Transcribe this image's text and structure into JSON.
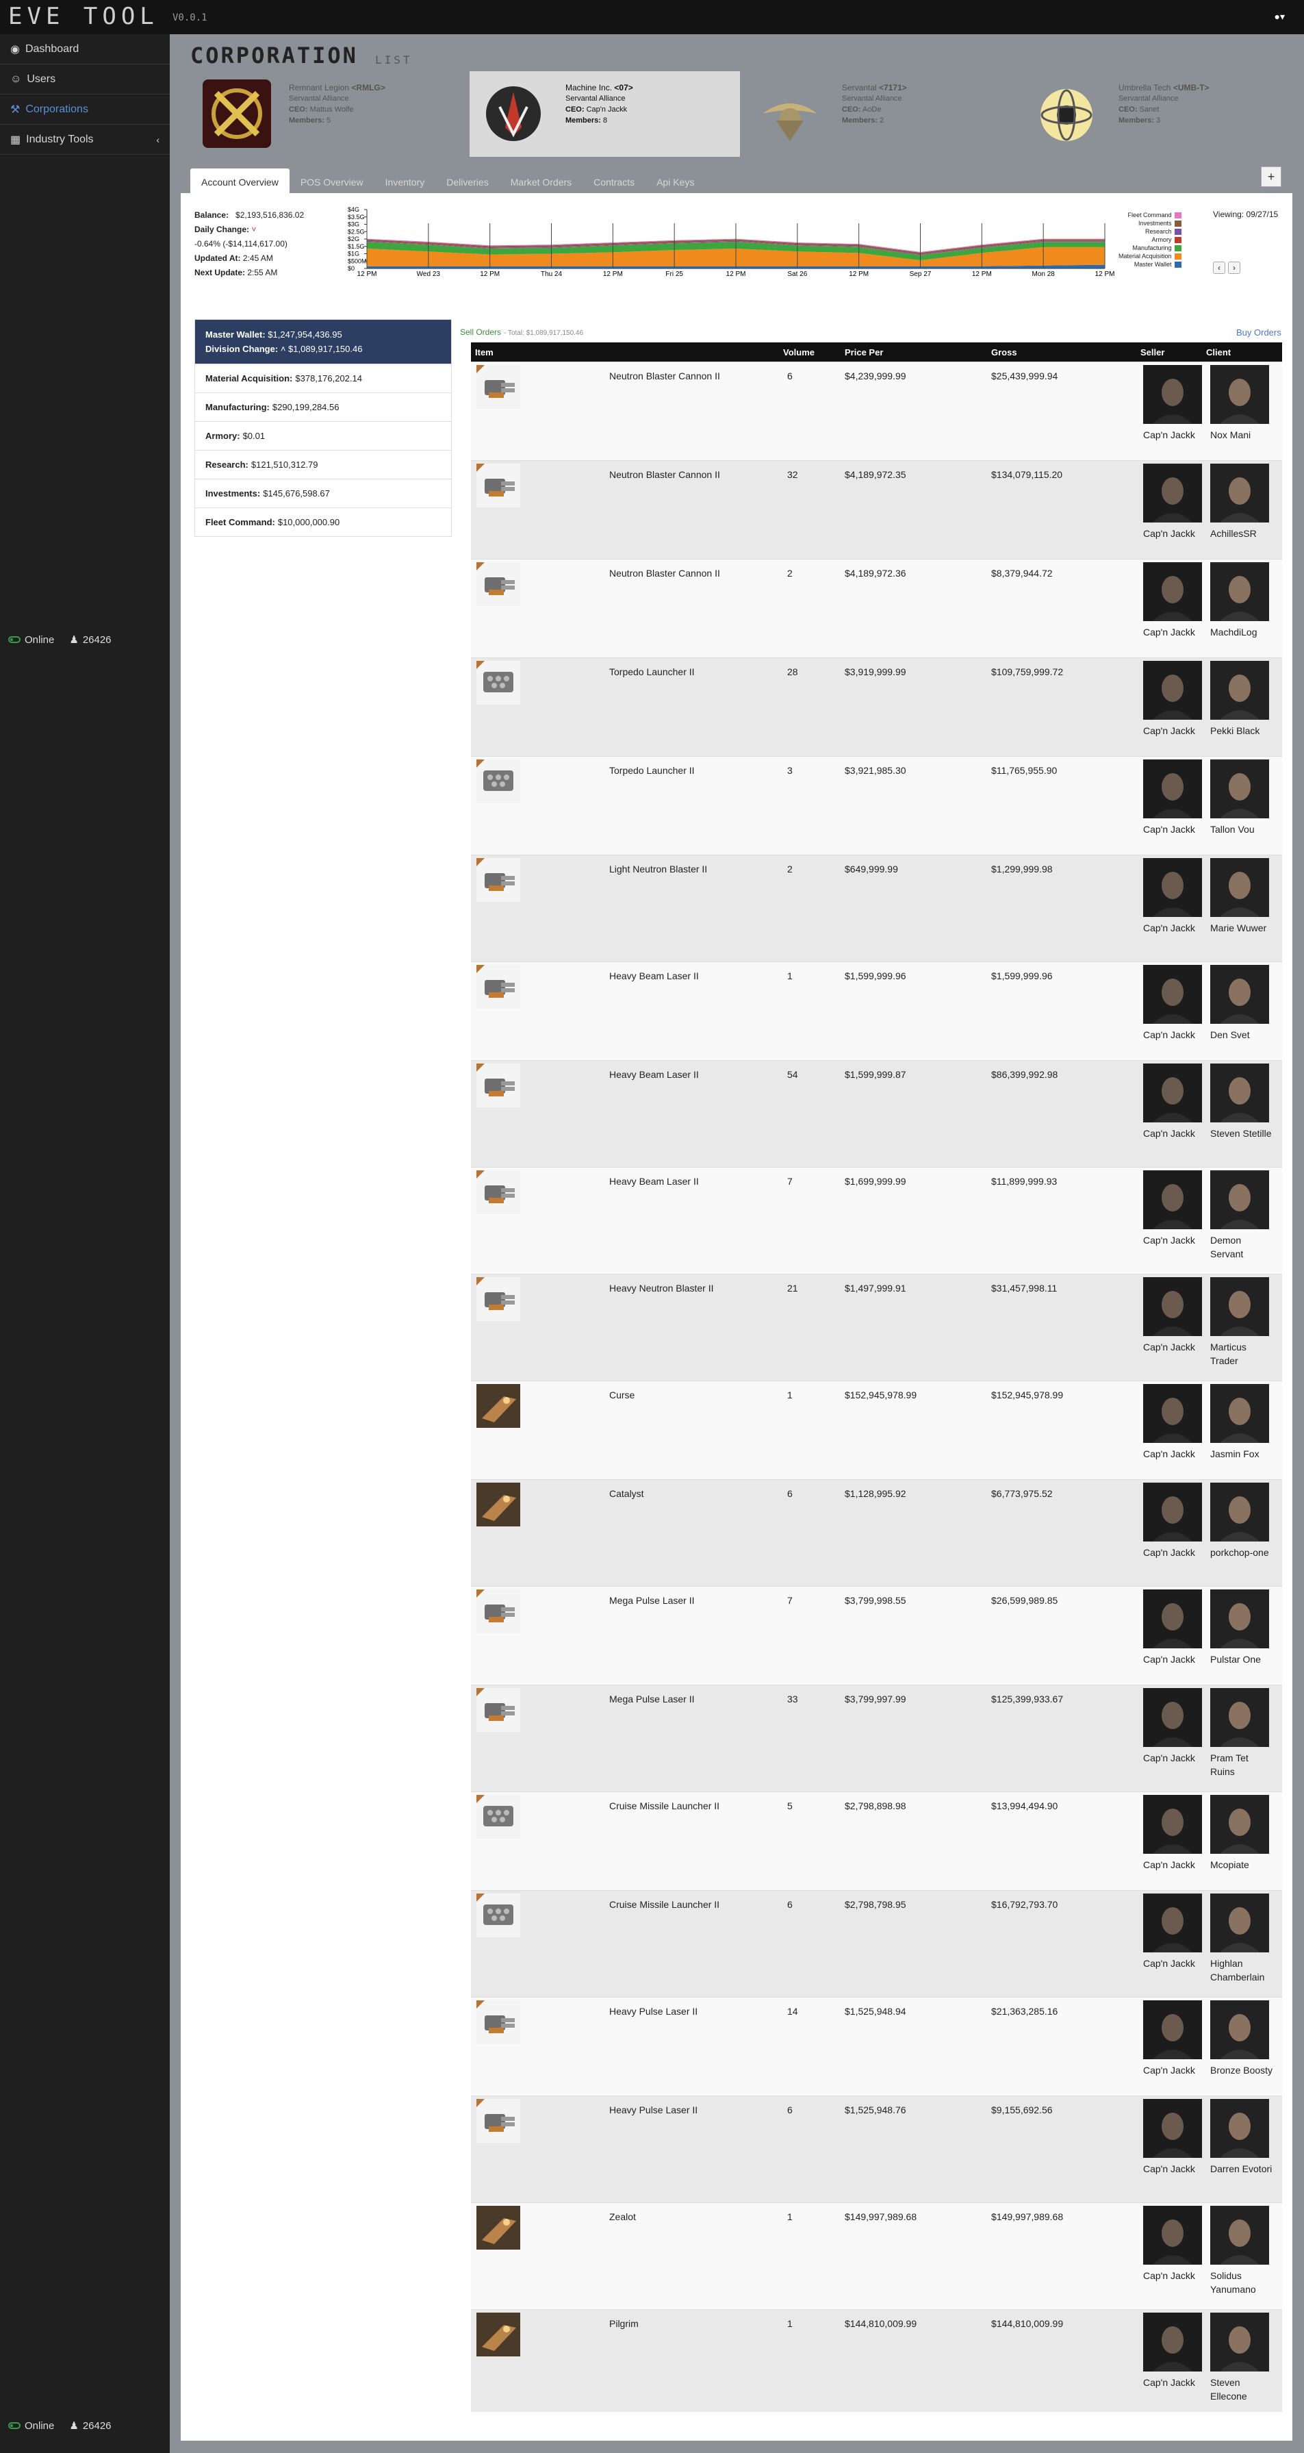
{
  "app": {
    "logo": "EVE TOOL",
    "version": "V0.0.1"
  },
  "sidebar": {
    "items": [
      {
        "icon": "dashboard-icon",
        "label": "Dashboard"
      },
      {
        "icon": "users-icon",
        "label": "Users"
      },
      {
        "icon": "wrench-icon",
        "label": "Corporations"
      },
      {
        "icon": "industry-icon",
        "label": "Industry Tools"
      }
    ],
    "online_label": "Online",
    "online_count": "26426"
  },
  "page": {
    "title": "CORPORATION",
    "subtitle": "LIST"
  },
  "corporations": [
    {
      "name": "Remnant Legion",
      "ticker": "<RMLG>",
      "alliance": "Servantal Alliance",
      "ceo_label": "CEO:",
      "ceo": "Mattus Wolfe",
      "members_label": "Members:",
      "members": "5"
    },
    {
      "name": "Machine Inc.",
      "ticker": "<07>",
      "alliance": "Servantal Alliance",
      "ceo_label": "CEO:",
      "ceo": "Cap'n Jackk",
      "members_label": "Members:",
      "members": "8"
    },
    {
      "name": "Servantal",
      "ticker": "<7171>",
      "alliance": "Servantal Alliance",
      "ceo_label": "CEO:",
      "ceo": "AoDe",
      "members_label": "Members:",
      "members": "2"
    },
    {
      "name": "Umbrella Tech",
      "ticker": "<UMB-T>",
      "alliance": "Servantal Alliance",
      "ceo_label": "CEO:",
      "ceo": "Sanet",
      "members_label": "Members:",
      "members": "3"
    }
  ],
  "tabs": [
    "Account Overview",
    "POS Overview",
    "Inventory",
    "Deliveries",
    "Market Orders",
    "Contracts",
    "Api Keys"
  ],
  "plus_label": "+",
  "balance": {
    "balance_label": "Balance:",
    "balance": "$2,193,516,836.02",
    "daily_change_label": "Daily Change:",
    "daily_change": "-0.64% (-$14,114,617.00)",
    "updated_label": "Updated At:",
    "updated": "2:45 AM",
    "next_label": "Next Update:",
    "next": "2:55 AM"
  },
  "viewing": "Viewing: 09/27/15",
  "chart_data": {
    "type": "area",
    "x": [
      "12 PM",
      "Wed 23",
      "12 PM",
      "Thu 24",
      "12 PM",
      "Fri 25",
      "12 PM",
      "Sat 26",
      "12 PM",
      "Sep 27",
      "12 PM",
      "Mon 28",
      "12 PM"
    ],
    "yticks": [
      "$4G",
      "$3.5G",
      "$3G",
      "$2.5G",
      "$2G",
      "$1.5G",
      "$1G",
      "$500M",
      "$0"
    ],
    "ylim": [
      0,
      4
    ],
    "series": [
      {
        "name": "Master Wallet",
        "color": "#2b6cb0",
        "values": [
          0.15,
          0.15,
          0.15,
          0.15,
          0.15,
          0.15,
          0.15,
          0.15,
          0.15,
          0.15,
          0.15,
          0.2,
          0.25
        ]
      },
      {
        "name": "Material Acquisition",
        "color": "#f08a1d",
        "values": [
          1.2,
          1.0,
          0.8,
          0.85,
          0.95,
          1.1,
          1.2,
          1.0,
          0.9,
          0.4,
          0.9,
          1.25,
          1.2
        ]
      },
      {
        "name": "Manufacturing",
        "color": "#3ea63e",
        "values": [
          0.45,
          0.45,
          0.4,
          0.4,
          0.45,
          0.45,
          0.45,
          0.4,
          0.4,
          0.35,
          0.35,
          0.35,
          0.35
        ]
      },
      {
        "name": "Armory",
        "color": "#c0392b",
        "values": [
          0.02,
          0.02,
          0.02,
          0.02,
          0.02,
          0.02,
          0.02,
          0.02,
          0.02,
          0.02,
          0.02,
          0.02,
          0.02
        ]
      },
      {
        "name": "Research",
        "color": "#7b4fa3",
        "values": [
          0.05,
          0.05,
          0.05,
          0.05,
          0.05,
          0.05,
          0.05,
          0.05,
          0.05,
          0.05,
          0.05,
          0.05,
          0.05
        ]
      },
      {
        "name": "Investments",
        "color": "#8a5a3b",
        "values": [
          0.1,
          0.1,
          0.1,
          0.1,
          0.1,
          0.1,
          0.1,
          0.1,
          0.1,
          0.1,
          0.1,
          0.1,
          0.1
        ]
      },
      {
        "name": "Fleet Command",
        "color": "#e377c2",
        "values": [
          0.05,
          0.05,
          0.05,
          0.05,
          0.05,
          0.05,
          0.05,
          0.05,
          0.05,
          0.05,
          0.05,
          0.05,
          0.05
        ]
      }
    ]
  },
  "divisions": {
    "master_label": "Master Wallet:",
    "master": "$1,247,954,436.95",
    "change_label": "Division Change:",
    "change": "$1,089,917,150.46",
    "rows": [
      {
        "label": "Material Acquisition:",
        "value": "$378,176,202.14"
      },
      {
        "label": "Manufacturing:",
        "value": "$290,199,284.56"
      },
      {
        "label": "Armory:",
        "value": "$0.01"
      },
      {
        "label": "Research:",
        "value": "$121,510,312.79"
      },
      {
        "label": "Investments:",
        "value": "$145,676,598.67"
      },
      {
        "label": "Fleet Command:",
        "value": "$10,000,000.90"
      }
    ]
  },
  "orders": {
    "title": "Sell Orders",
    "total": "- Total: $1,089,917,150.46",
    "buy_link": "Buy Orders",
    "columns": [
      "Item",
      "Volume",
      "Price Per",
      "Gross",
      "Seller",
      "Client"
    ],
    "rows": [
      {
        "item": "Neutron Blaster Cannon II",
        "icon": "turret-icon",
        "volume": "6",
        "price": "$4,239,999.99",
        "gross": "$25,439,999.94",
        "seller": "Cap'n Jackk",
        "client": "Nox Mani"
      },
      {
        "item": "Neutron Blaster Cannon II",
        "icon": "turret-icon",
        "volume": "32",
        "price": "$4,189,972.35",
        "gross": "$134,079,115.20",
        "seller": "Cap'n Jackk",
        "client": "AchillesSR"
      },
      {
        "item": "Neutron Blaster Cannon II",
        "icon": "turret-icon",
        "volume": "2",
        "price": "$4,189,972.36",
        "gross": "$8,379,944.72",
        "seller": "Cap'n Jackk",
        "client": "MachdiLog"
      },
      {
        "item": "Torpedo Launcher II",
        "icon": "launcher-icon",
        "volume": "28",
        "price": "$3,919,999.99",
        "gross": "$109,759,999.72",
        "seller": "Cap'n Jackk",
        "client": "Pekki Black"
      },
      {
        "item": "Torpedo Launcher II",
        "icon": "launcher-icon",
        "volume": "3",
        "price": "$3,921,985.30",
        "gross": "$11,765,955.90",
        "seller": "Cap'n Jackk",
        "client": "Tallon Vou"
      },
      {
        "item": "Light Neutron Blaster II",
        "icon": "turret-icon",
        "volume": "2",
        "price": "$649,999.99",
        "gross": "$1,299,999.98",
        "seller": "Cap'n Jackk",
        "client": "Marie Wuwer"
      },
      {
        "item": "Heavy Beam Laser II",
        "icon": "turret-icon",
        "volume": "1",
        "price": "$1,599,999.96",
        "gross": "$1,599,999.96",
        "seller": "Cap'n Jackk",
        "client": "Den Svet"
      },
      {
        "item": "Heavy Beam Laser II",
        "icon": "turret-icon",
        "volume": "54",
        "price": "$1,599,999.87",
        "gross": "$86,399,992.98",
        "seller": "Cap'n Jackk",
        "client": "Steven Stetille"
      },
      {
        "item": "Heavy Beam Laser II",
        "icon": "turret-icon",
        "volume": "7",
        "price": "$1,699,999.99",
        "gross": "$11,899,999.93",
        "seller": "Cap'n Jackk",
        "client": "Demon Servant"
      },
      {
        "item": "Heavy Neutron Blaster II",
        "icon": "turret-icon",
        "volume": "21",
        "price": "$1,497,999.91",
        "gross": "$31,457,998.11",
        "seller": "Cap'n Jackk",
        "client": "Marticus Trader"
      },
      {
        "item": "Curse",
        "icon": "ship-icon",
        "volume": "1",
        "price": "$152,945,978.99",
        "gross": "$152,945,978.99",
        "seller": "Cap'n Jackk",
        "client": "Jasmin Fox"
      },
      {
        "item": "Catalyst",
        "icon": "ship-icon",
        "volume": "6",
        "price": "$1,128,995.92",
        "gross": "$6,773,975.52",
        "seller": "Cap'n Jackk",
        "client": "porkchop-one"
      },
      {
        "item": "Mega Pulse Laser II",
        "icon": "turret-icon",
        "volume": "7",
        "price": "$3,799,998.55",
        "gross": "$26,599,989.85",
        "seller": "Cap'n Jackk",
        "client": "Pulstar One"
      },
      {
        "item": "Mega Pulse Laser II",
        "icon": "turret-icon",
        "volume": "33",
        "price": "$3,799,997.99",
        "gross": "$125,399,933.67",
        "seller": "Cap'n Jackk",
        "client": "Pram Tet Ruins"
      },
      {
        "item": "Cruise Missile Launcher II",
        "icon": "launcher-icon",
        "volume": "5",
        "price": "$2,798,898.98",
        "gross": "$13,994,494.90",
        "seller": "Cap'n Jackk",
        "client": "Mcopiate"
      },
      {
        "item": "Cruise Missile Launcher II",
        "icon": "launcher-icon",
        "volume": "6",
        "price": "$2,798,798.95",
        "gross": "$16,792,793.70",
        "seller": "Cap'n Jackk",
        "client": "Highlan Chamberlain"
      },
      {
        "item": "Heavy Pulse Laser II",
        "icon": "turret-icon",
        "volume": "14",
        "price": "$1,525,948.94",
        "gross": "$21,363,285.16",
        "seller": "Cap'n Jackk",
        "client": "Bronze Boosty"
      },
      {
        "item": "Heavy Pulse Laser II",
        "icon": "turret-icon",
        "volume": "6",
        "price": "$1,525,948.76",
        "gross": "$9,155,692.56",
        "seller": "Cap'n Jackk",
        "client": "Darren Evotori"
      },
      {
        "item": "Zealot",
        "icon": "ship-icon",
        "volume": "1",
        "price": "$149,997,989.68",
        "gross": "$149,997,989.68",
        "seller": "Cap'n Jackk",
        "client": "Solidus Yanumano"
      },
      {
        "item": "Pilgrim",
        "icon": "ship-icon",
        "volume": "1",
        "price": "$144,810,009.99",
        "gross": "$144,810,009.99",
        "seller": "Cap'n Jackk",
        "client": "Steven Ellecone"
      }
    ]
  }
}
